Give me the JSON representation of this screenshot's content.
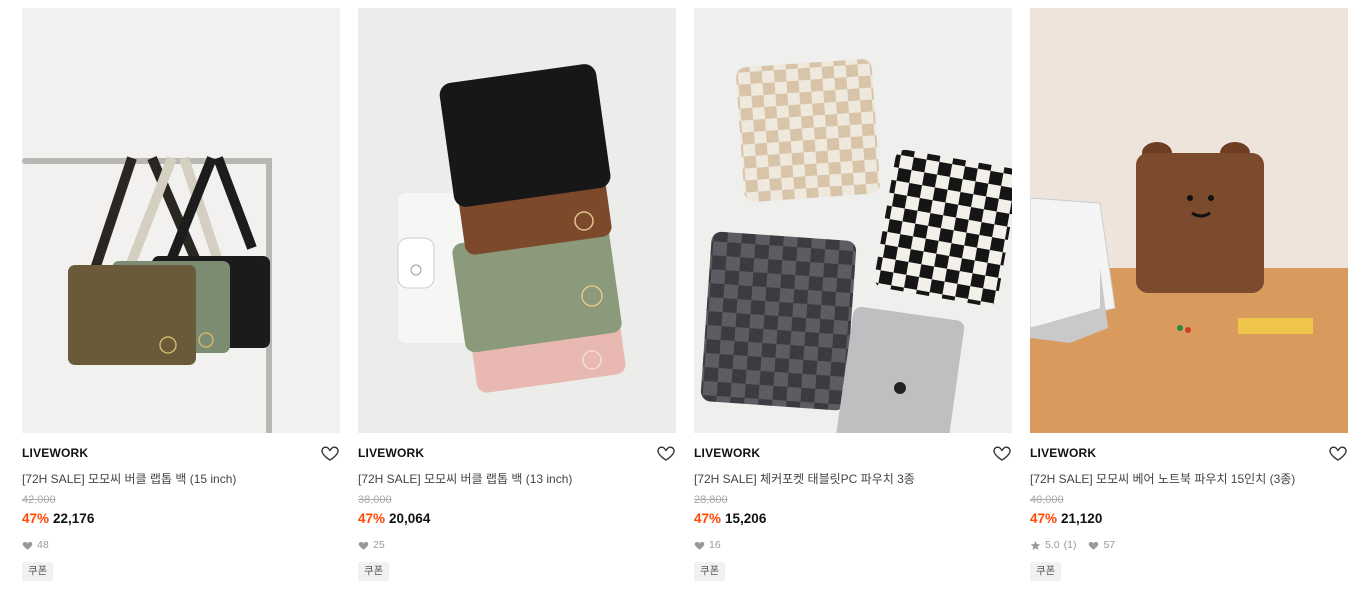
{
  "products": [
    {
      "brand": "LIVEWORK",
      "title": "[72H SALE] 모모씨 버클 랩톱 백 (15 inch)",
      "original_price": "42,000",
      "discount": "47%",
      "price": "22,176",
      "likes": "48",
      "rating": null,
      "reviews": null,
      "coupon": "쿠폰",
      "image": "olive green, sage and black laptop bags with buckle straps hanging on a metal rack"
    },
    {
      "brand": "LIVEWORK",
      "title": "[72H SALE] 모모씨 버클 랩톱 백 (13 inch)",
      "original_price": "38,000",
      "discount": "47%",
      "price": "20,064",
      "likes": "25",
      "rating": null,
      "reviews": null,
      "coupon": "쿠폰",
      "image": "stack of black, brown, sage and pink laptop bags with smiley logo"
    },
    {
      "brand": "LIVEWORK",
      "title": "[72H SALE] 체커포켓 태블릿PC 파우치 3종",
      "original_price": "28,800",
      "discount": "47%",
      "price": "15,206",
      "likes": "16",
      "rating": null,
      "reviews": null,
      "coupon": "쿠폰",
      "image": "beige, grey and black checkerboard tablet pouches with a tablet"
    },
    {
      "brand": "LIVEWORK",
      "title": "[72H SALE] 모모씨 베어 노트북 파우치 15인치 (3종)",
      "original_price": "40,000",
      "discount": "47%",
      "price": "21,120",
      "likes": "57",
      "rating": "5.0",
      "reviews": "(1)",
      "coupon": "쿠폰",
      "image": "brown bear-face laptop pouch on an orange table next to a laptop"
    }
  ],
  "colors": {
    "discount": "#ff4800",
    "muted": "#999999"
  },
  "icons": {
    "wishlist": "heart-outline-icon",
    "likes": "heart-filled-icon",
    "rating": "star-icon"
  }
}
